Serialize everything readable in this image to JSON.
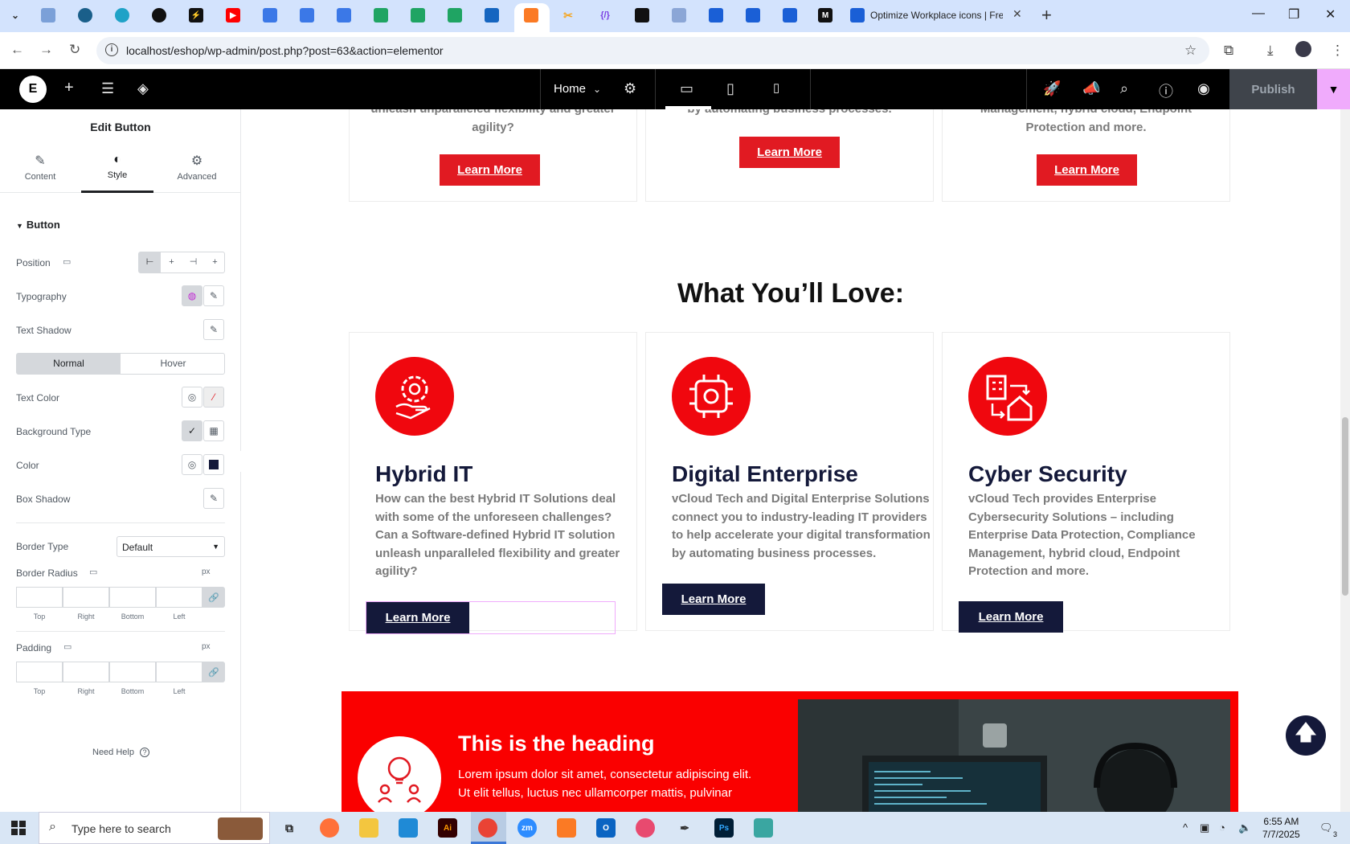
{
  "browser": {
    "active_tab_title": "Optimize Workplace icons | Fre",
    "url": "localhost/eshop/wp-admin/post.php?post=63&action=elementor"
  },
  "elementor_bar": {
    "page_label": "Home",
    "publish_label": "Publish"
  },
  "panel": {
    "title": "Edit Button",
    "tabs": [
      {
        "label": "Content",
        "icon": "pencil-icon"
      },
      {
        "label": "Style",
        "icon": "contrast-icon"
      },
      {
        "label": "Advanced",
        "icon": "gear-icon"
      }
    ],
    "section_title": "Button",
    "labels": {
      "position": "Position",
      "typography": "Typography",
      "text_shadow": "Text Shadow",
      "text_color": "Text Color",
      "background_type": "Background Type",
      "color": "Color",
      "box_shadow": "Box Shadow",
      "border_type": "Border Type",
      "border_radius": "Border Radius",
      "padding": "Padding"
    },
    "state_tabs": [
      "Normal",
      "Hover"
    ],
    "border_type_value": "Default",
    "unit": "px",
    "dim_labels": [
      "Top",
      "Right",
      "Bottom",
      "Left"
    ],
    "need_help": "Need Help",
    "color_swatch": "#14193a"
  },
  "canvas": {
    "top_cards": [
      {
        "text_lines": [
          "unleash unparalleled flexibility and greater",
          "agility?"
        ],
        "button": "Learn More"
      },
      {
        "text_lines": [
          "by automating business processes."
        ],
        "button": "Learn More"
      },
      {
        "text_lines": [
          "Management, hybrid cloud, Endpoint",
          "Protection and more."
        ],
        "button": "Learn More"
      }
    ],
    "section_heading": "What You’ll Love:",
    "cards": [
      {
        "icon": "gear-hand-icon",
        "title": "Hybrid IT",
        "text_lines": [
          "How can the best Hybrid IT Solutions deal",
          "with some of the unforeseen challenges?",
          "Can a Software-defined Hybrid IT solution",
          "unleash unparalleled flexibility and greater",
          "agility?"
        ],
        "button": "Learn More"
      },
      {
        "icon": "puzzle-hands-icon",
        "title": "Digital Enterprise",
        "text_lines": [
          "vCloud Tech and Digital Enterprise Solutions",
          "connect you to industry-leading IT providers",
          "to help accelerate your digital transformation",
          "by automating business processes."
        ],
        "button": "Learn More"
      },
      {
        "icon": "building-house-icon",
        "title": "Cyber Security",
        "text_lines": [
          "vCloud Tech provides Enterprise",
          "Cybersecurity Solutions – including",
          "Enterprise Data Protection, Compliance",
          "Management, hybrid cloud, Endpoint",
          "Protection and more."
        ],
        "button": "Learn More"
      }
    ],
    "red_section": {
      "heading": "This is the heading",
      "text_lines": [
        "Lorem ipsum dolor sit amet, consectetur adipiscing elit.",
        "Ut elit tellus, luctus nec ullamcorper mattis, pulvinar"
      ]
    }
  },
  "taskbar": {
    "search_placeholder": "Type here to search",
    "time": "6:55 AM",
    "date": "7/7/2025",
    "notifications": "3"
  },
  "colors": {
    "accent_red": "#e11a22",
    "navy": "#14193a",
    "elementor_pink": "#f0abfc"
  }
}
